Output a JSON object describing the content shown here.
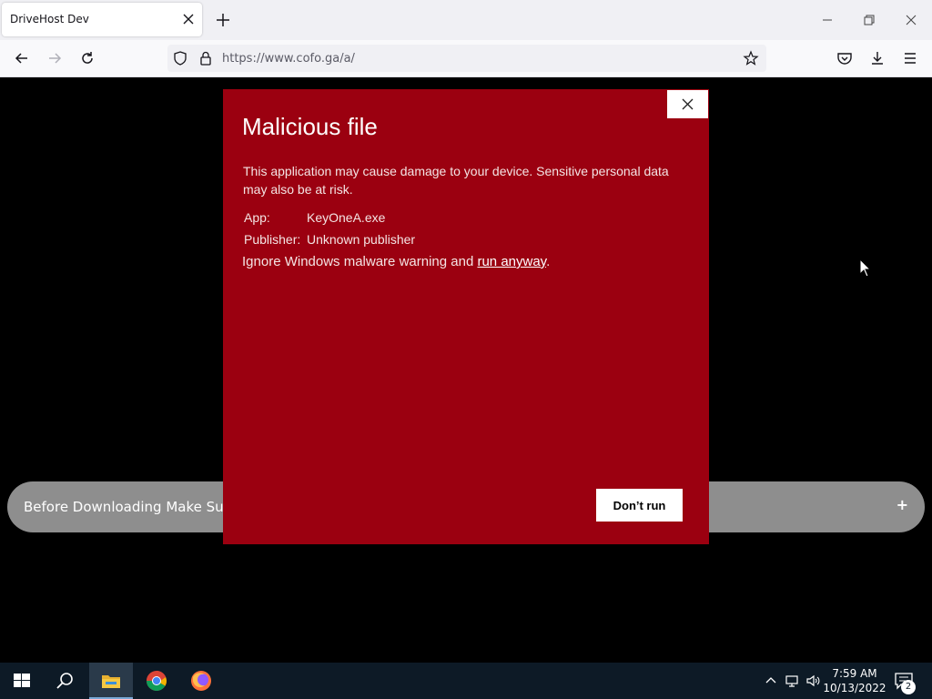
{
  "browser": {
    "tab_title": "DriveHost Dev",
    "url": "https://www.cofo.ga/a/"
  },
  "page": {
    "accordion_label": "Before Downloading Make Sure",
    "accordion_toggle": "+"
  },
  "modal": {
    "title": "Malicious file",
    "description": "This application may cause damage to your device. Sensitive personal data may also be at risk.",
    "app_key": "App:",
    "app_value": "KeyOneA.exe",
    "publisher_key": "Publisher:",
    "publisher_value": "Unknown publisher",
    "ignore_prefix": "Ignore Windows malware warning and ",
    "ignore_link": "run anyway",
    "ignore_suffix": ".",
    "dont_run_label": "Don’t run",
    "background_color": "#9b0010"
  },
  "taskbar": {
    "time": "7:59 AM",
    "date": "10/13/2022",
    "notification_count": "2",
    "apps": [
      "windows-start-icon",
      "search-icon",
      "file-explorer-icon",
      "chrome-icon",
      "firefox-icon"
    ]
  }
}
